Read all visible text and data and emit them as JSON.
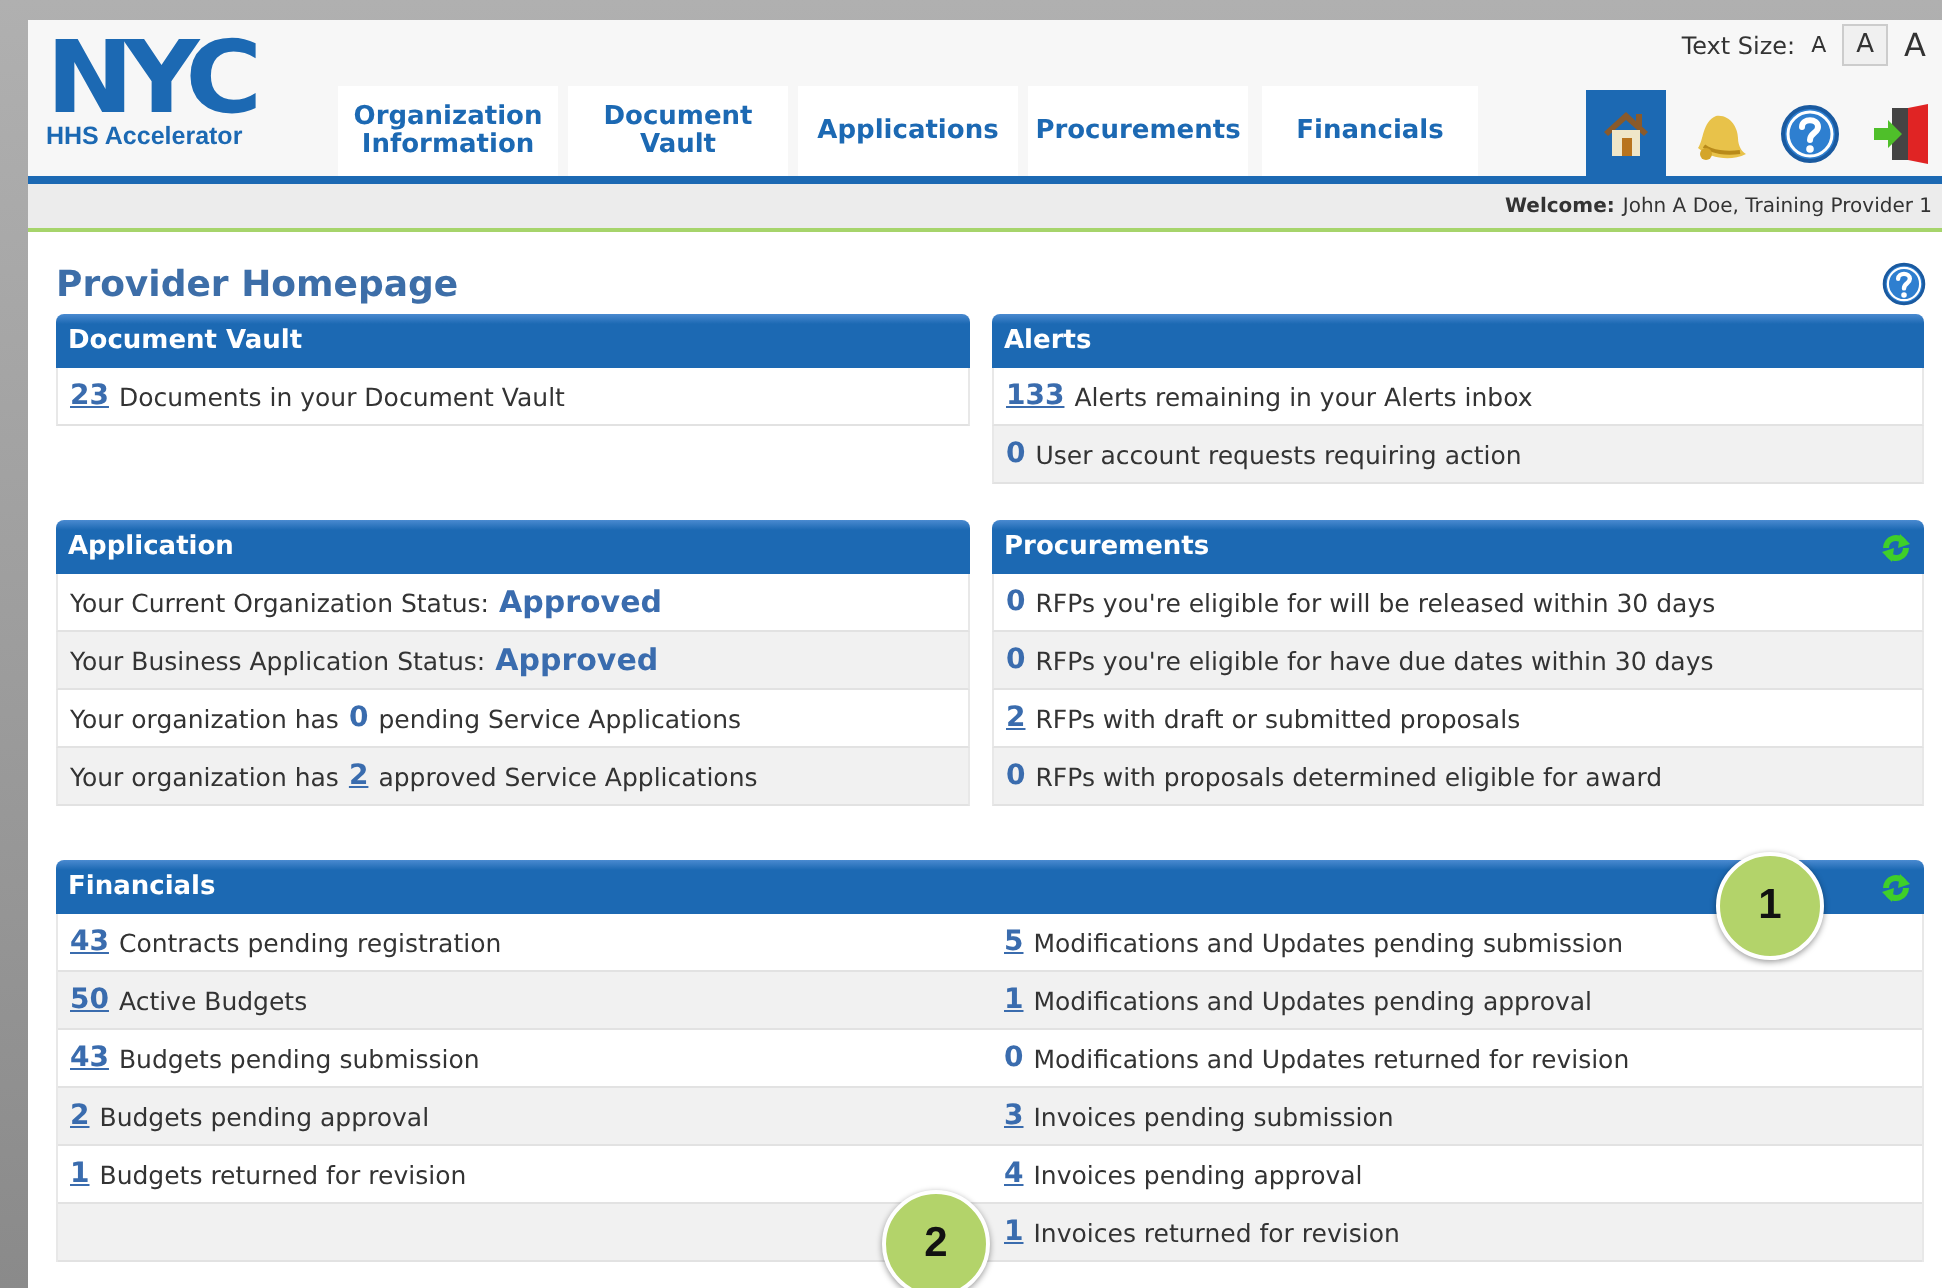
{
  "header": {
    "logo": {
      "mark": "NYC",
      "subtitle": "HHS Accelerator"
    },
    "text_size": {
      "label": "Text Size:",
      "options": [
        {
          "label": "A",
          "selected": false
        },
        {
          "label": "A",
          "selected": true
        },
        {
          "label": "A",
          "selected": false
        }
      ]
    },
    "tabs": [
      {
        "label": "Organization Information",
        "selected": false
      },
      {
        "label": "Document Vault",
        "selected": false
      },
      {
        "label": "Applications",
        "selected": false
      },
      {
        "label": "Procurements",
        "selected": false
      },
      {
        "label": "Financials",
        "selected": false
      }
    ],
    "icons": [
      {
        "kind": "home",
        "selected": true
      },
      {
        "kind": "alerts",
        "selected": false
      },
      {
        "kind": "help",
        "selected": false
      },
      {
        "kind": "logout",
        "selected": false
      }
    ]
  },
  "welcome": {
    "label": "Welcome:",
    "user": "John A Doe, Training Provider 1"
  },
  "page": {
    "title": "Provider Homepage"
  },
  "panels": [
    {
      "title": "Document Vault",
      "refresh": false,
      "rows": [
        {
          "kind": "count",
          "count": "23",
          "linked": true,
          "text": "Documents in your Document Vault"
        }
      ]
    },
    {
      "title": "Alerts",
      "refresh": false,
      "rows": [
        {
          "kind": "count",
          "count": "133",
          "linked": true,
          "text": "Alerts remaining in your Alerts inbox"
        },
        {
          "kind": "count",
          "count": "0",
          "linked": false,
          "text": "User account requests requiring action"
        }
      ]
    },
    {
      "title": "Application",
      "refresh": false,
      "rows": [
        {
          "kind": "status",
          "label": "Your Current Organization Status:",
          "value": "Approved"
        },
        {
          "kind": "status",
          "label": "Your Business Application Status:",
          "value": "Approved"
        },
        {
          "kind": "sentence",
          "pre": "Your organization has",
          "count": "0",
          "linked": false,
          "post": "pending Service Applications"
        },
        {
          "kind": "sentence",
          "pre": "Your organization has",
          "count": "2",
          "linked": true,
          "post": "approved Service Applications"
        }
      ]
    },
    {
      "title": "Procurements",
      "refresh": true,
      "rows": [
        {
          "kind": "count",
          "count": "0",
          "linked": false,
          "text": "RFPs you're eligible for will be released within 30 days"
        },
        {
          "kind": "count",
          "count": "0",
          "linked": false,
          "text": "RFPs you're eligible for have due dates within 30 days"
        },
        {
          "kind": "count",
          "count": "2",
          "linked": true,
          "text": "RFPs with draft or submitted proposals"
        },
        {
          "kind": "count",
          "count": "0",
          "linked": false,
          "text": "RFPs with proposals determined eligible for award"
        }
      ]
    }
  ],
  "financials": {
    "title": "Financials",
    "refresh": true,
    "columns": [
      [
        {
          "kind": "count",
          "count": "43",
          "linked": true,
          "text": "Contracts pending registration"
        },
        {
          "kind": "count",
          "count": "50",
          "linked": true,
          "text": "Active Budgets"
        },
        {
          "kind": "count",
          "count": "43",
          "linked": true,
          "text": "Budgets pending submission"
        },
        {
          "kind": "count",
          "count": "2",
          "linked": true,
          "text": "Budgets pending approval"
        },
        {
          "kind": "count",
          "count": "1",
          "linked": true,
          "text": "Budgets returned for revision"
        }
      ],
      [
        {
          "kind": "count",
          "count": "5",
          "linked": true,
          "text": "Modifications and Updates pending submission"
        },
        {
          "kind": "count",
          "count": "1",
          "linked": true,
          "text": "Modifications and Updates pending approval"
        },
        {
          "kind": "count",
          "count": "0",
          "linked": false,
          "text": "Modifications and Updates returned for revision"
        },
        {
          "kind": "count",
          "count": "3",
          "linked": true,
          "text": "Invoices pending submission"
        },
        {
          "kind": "count",
          "count": "4",
          "linked": true,
          "text": "Invoices pending approval"
        },
        {
          "kind": "count",
          "count": "1",
          "linked": true,
          "text": "Invoices returned for revision"
        }
      ]
    ]
  },
  "callouts": [
    {
      "label": "1"
    },
    {
      "label": "2"
    }
  ]
}
